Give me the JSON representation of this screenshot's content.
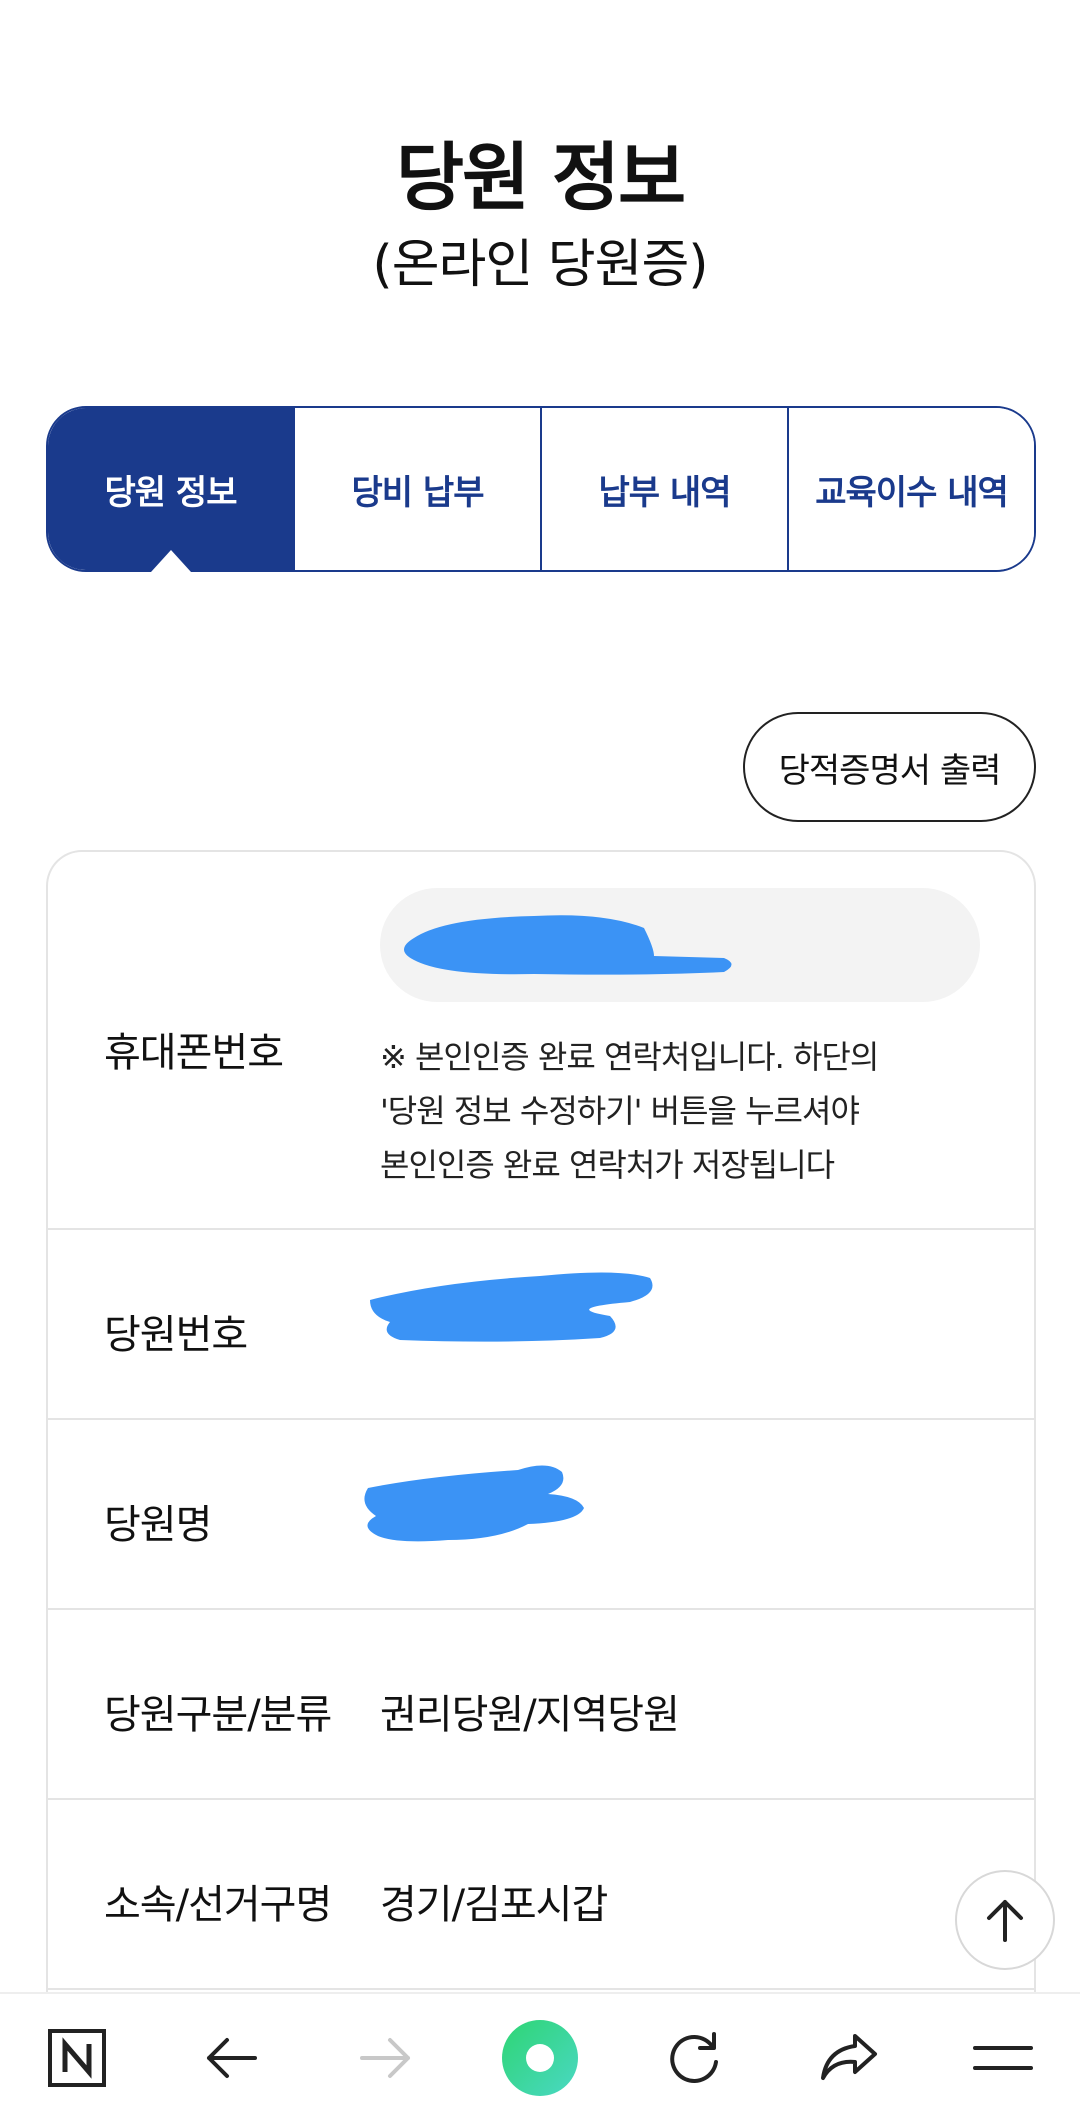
{
  "header": {
    "title": "당원 정보",
    "subtitle": "(온라인 당원증)"
  },
  "tabs": [
    {
      "label": "당원 정보",
      "active": true
    },
    {
      "label": "당비 납부",
      "active": false
    },
    {
      "label": "납부 내역",
      "active": false
    },
    {
      "label": "교육이수 내역",
      "active": false
    }
  ],
  "print_button": {
    "label": "당적증명서 출력"
  },
  "info": {
    "phone": {
      "label": "휴대폰번호",
      "note_lines": [
        "※ 본인인증 완료 연락처입니다. 하단의",
        "'당원 정보 수정하기' 버튼을 누르셔야",
        "본인인증 완료 연락처가 저장됩니다"
      ]
    },
    "member_no": {
      "label": "당원번호"
    },
    "member_name": {
      "label": "당원명"
    },
    "member_type": {
      "label": "당원구분/분류",
      "value": "권리당원/지역당원"
    },
    "district": {
      "label": "소속/선거구명",
      "value": "경기/김포시갑"
    }
  },
  "colors": {
    "accent": "#1a3a8c",
    "redaction": "#3b93f5",
    "border": "#e4e4e4"
  },
  "icons": {
    "scroll_top": "arrow-up-icon",
    "nav": [
      "naver-n-icon",
      "back-arrow-icon",
      "forward-arrow-icon",
      "green-dot-icon",
      "refresh-icon",
      "share-icon",
      "menu-icon"
    ]
  }
}
